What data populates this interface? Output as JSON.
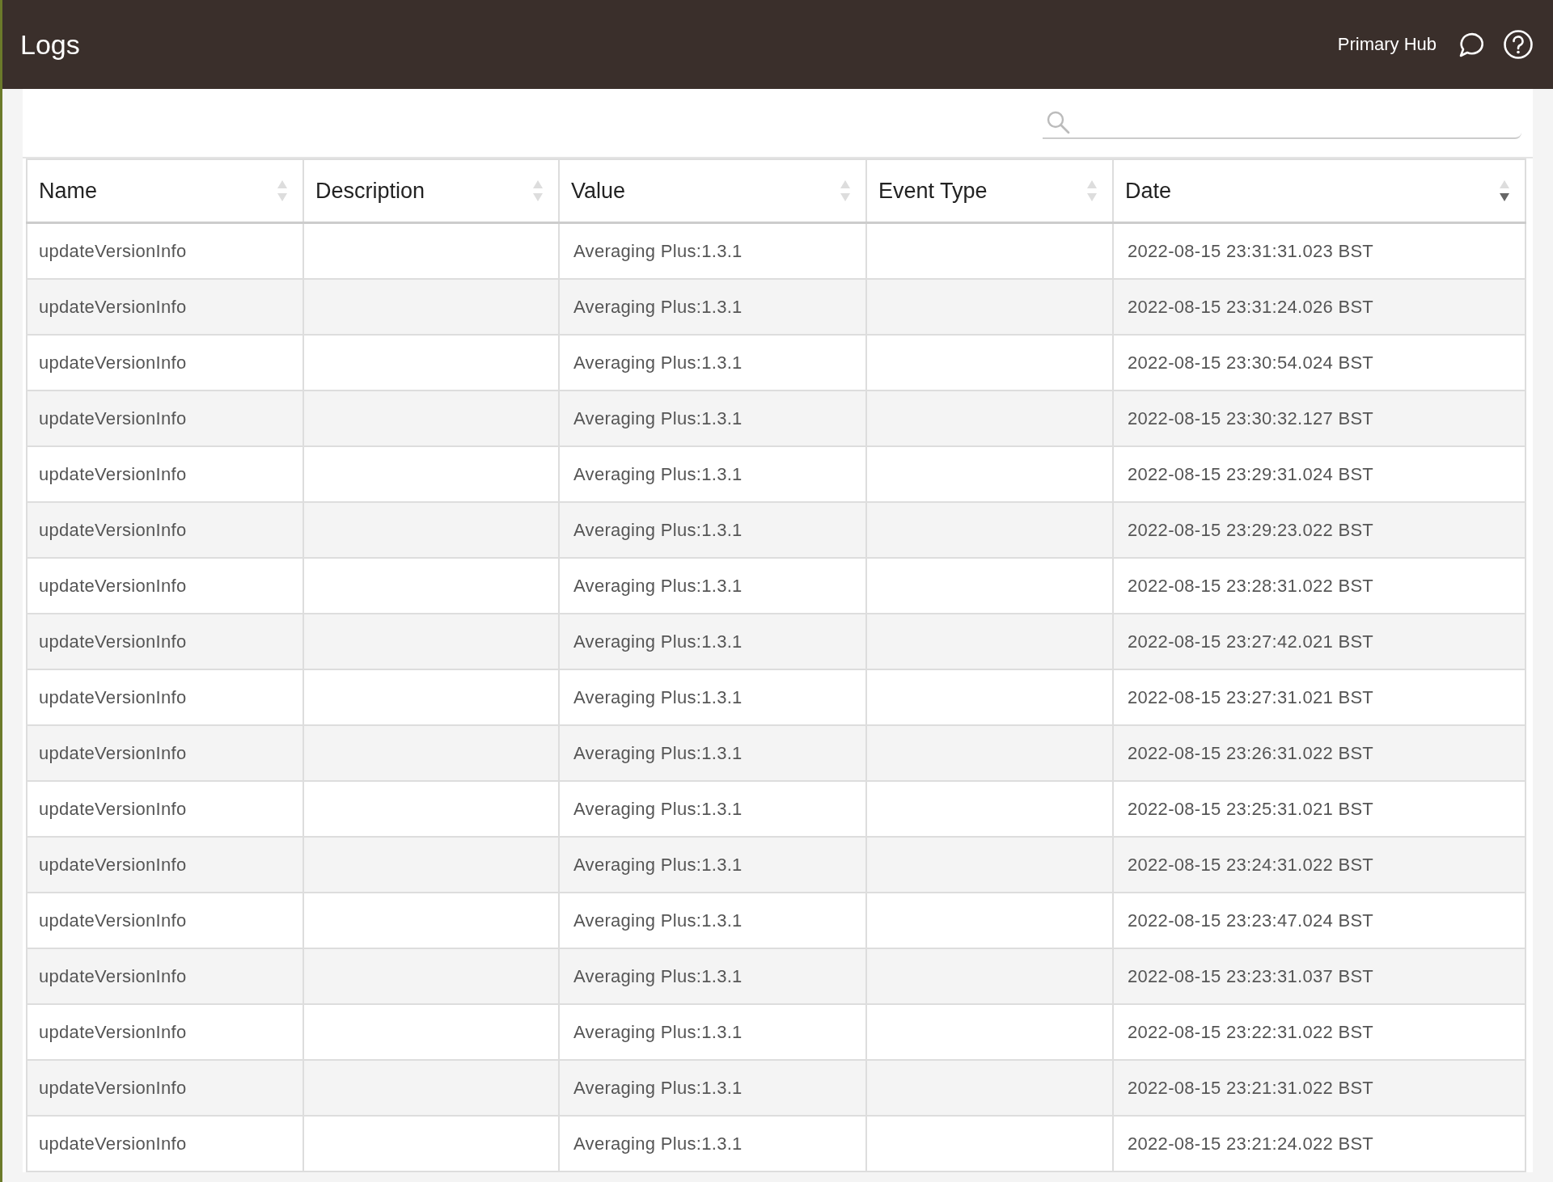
{
  "app_bar": {
    "title": "Logs",
    "hub_name": "Primary Hub"
  },
  "table": {
    "columns": [
      {
        "label": "Name",
        "sorted_descending": false
      },
      {
        "label": "Description",
        "sorted_descending": false
      },
      {
        "label": "Value",
        "sorted_descending": false
      },
      {
        "label": "Event Type",
        "sorted_descending": false
      },
      {
        "label": "Date",
        "sorted_descending": true
      }
    ],
    "rows": [
      {
        "name": "updateVersionInfo",
        "value": "Averaging Plus:1.3.1",
        "date": "2022-08-15 23:31:31.023 BST"
      },
      {
        "name": "updateVersionInfo",
        "value": "Averaging Plus:1.3.1",
        "date": "2022-08-15 23:31:24.026 BST"
      },
      {
        "name": "updateVersionInfo",
        "value": "Averaging Plus:1.3.1",
        "date": "2022-08-15 23:30:54.024 BST"
      },
      {
        "name": "updateVersionInfo",
        "value": "Averaging Plus:1.3.1",
        "date": "2022-08-15 23:30:32.127 BST"
      },
      {
        "name": "updateVersionInfo",
        "value": "Averaging Plus:1.3.1",
        "date": "2022-08-15 23:29:31.024 BST"
      },
      {
        "name": "updateVersionInfo",
        "value": "Averaging Plus:1.3.1",
        "date": "2022-08-15 23:29:23.022 BST"
      },
      {
        "name": "updateVersionInfo",
        "value": "Averaging Plus:1.3.1",
        "date": "2022-08-15 23:28:31.022 BST"
      },
      {
        "name": "updateVersionInfo",
        "value": "Averaging Plus:1.3.1",
        "date": "2022-08-15 23:27:42.021 BST"
      },
      {
        "name": "updateVersionInfo",
        "value": "Averaging Plus:1.3.1",
        "date": "2022-08-15 23:27:31.021 BST"
      },
      {
        "name": "updateVersionInfo",
        "value": "Averaging Plus:1.3.1",
        "date": "2022-08-15 23:26:31.022 BST"
      },
      {
        "name": "updateVersionInfo",
        "value": "Averaging Plus:1.3.1",
        "date": "2022-08-15 23:25:31.021 BST"
      },
      {
        "name": "updateVersionInfo",
        "value": "Averaging Plus:1.3.1",
        "date": "2022-08-15 23:24:31.022 BST"
      },
      {
        "name": "updateVersionInfo",
        "value": "Averaging Plus:1.3.1",
        "date": "2022-08-15 23:23:47.024 BST"
      },
      {
        "name": "updateVersionInfo",
        "value": "Averaging Plus:1.3.1",
        "date": "2022-08-15 23:23:31.037 BST"
      },
      {
        "name": "updateVersionInfo",
        "value": "Averaging Plus:1.3.1",
        "date": "2022-08-15 23:22:31.022 BST"
      },
      {
        "name": "updateVersionInfo",
        "value": "Averaging Plus:1.3.1",
        "date": "2022-08-15 23:21:31.022 BST"
      },
      {
        "name": "updateVersionInfo",
        "value": "Averaging Plus:1.3.1",
        "date": "2022-08-15 23:21:24.022 BST"
      }
    ]
  }
}
